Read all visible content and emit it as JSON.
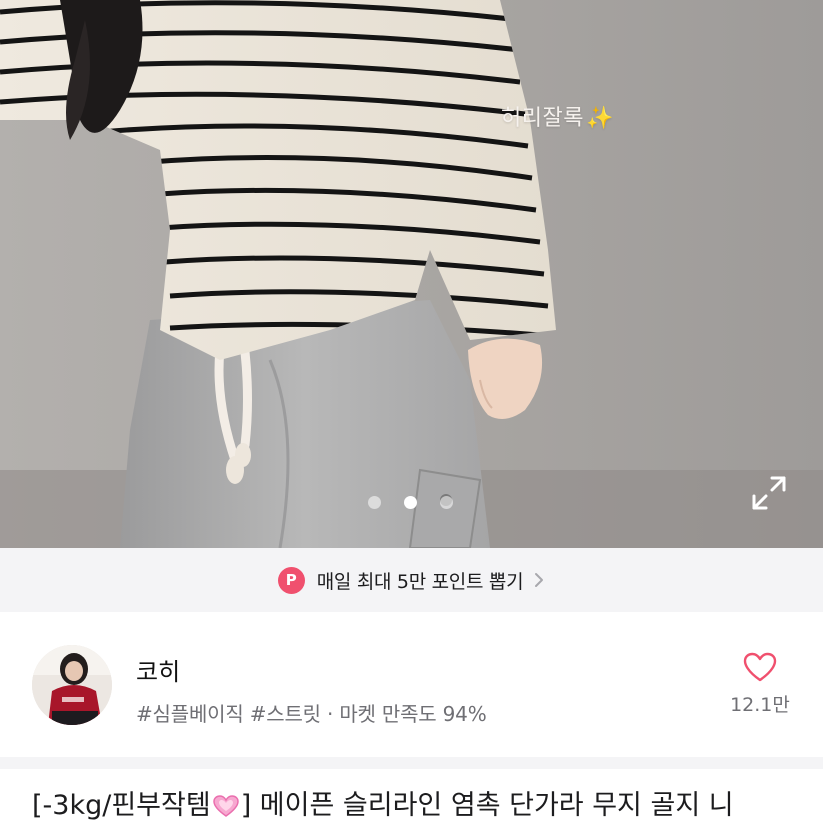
{
  "photo": {
    "caption": "허리잘록",
    "caption_sparkle": "✨",
    "carousel": {
      "total": 3,
      "active": 2
    },
    "expand_icon": "expand-icon"
  },
  "promo": {
    "badge": "P",
    "text": "매일 최대 5만 포인트 뽑기",
    "arrow_icon": "chevron-right-icon"
  },
  "store": {
    "name": "코히",
    "tags": "#심플베이직 #스트릿 · 마켓 만족도 94%",
    "like_count": "12.1만",
    "like_icon": "heart-outline-icon"
  },
  "product": {
    "title_prefix": "[-3kg/핀부작템",
    "title_suffix": "] 메이픈 슬리라인 염촉 단가라 무지 골지 니",
    "title_emoji": "pink-heart"
  },
  "colors": {
    "accent": "#f0506e",
    "text_primary": "#1c1c1e",
    "text_secondary": "#6f6f74",
    "banner_bg": "#f4f4f6"
  }
}
